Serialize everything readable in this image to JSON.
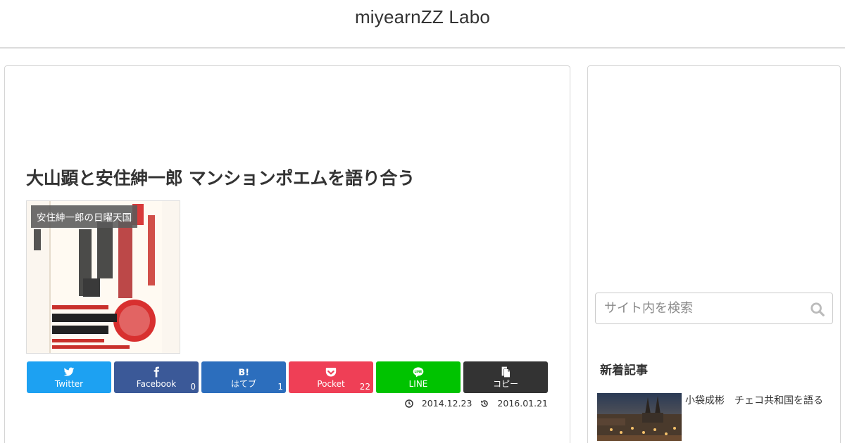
{
  "site": {
    "title": "miyearnZZ Labo"
  },
  "article": {
    "title": "大山顕と安住紳一郎 マンションポエムを語り合う",
    "category": "安住紳一郎の日曜天国",
    "published": "2014.12.23",
    "updated": "2016.01.21"
  },
  "share": [
    {
      "label": "Twitter",
      "count": "",
      "color": "#1da1f2",
      "icon": "twitter-icon"
    },
    {
      "label": "Facebook",
      "count": "0",
      "color": "#3b5998",
      "icon": "facebook-icon"
    },
    {
      "label": "はてブ",
      "count": "1",
      "color": "#2c6ebd",
      "icon": "hatena-icon"
    },
    {
      "label": "Pocket",
      "count": "22",
      "color": "#ef3f56",
      "icon": "pocket-icon"
    },
    {
      "label": "LINE",
      "count": "",
      "color": "#00c300",
      "icon": "line-icon"
    },
    {
      "label": "コピー",
      "count": "",
      "color": "#333333",
      "icon": "copy-icon"
    }
  ],
  "search": {
    "placeholder": "サイト内を検索"
  },
  "sidebar": {
    "new_entries_title": "新着記事",
    "new_entries": [
      {
        "title": "小袋成彬　チェコ共和国を語る"
      }
    ]
  }
}
